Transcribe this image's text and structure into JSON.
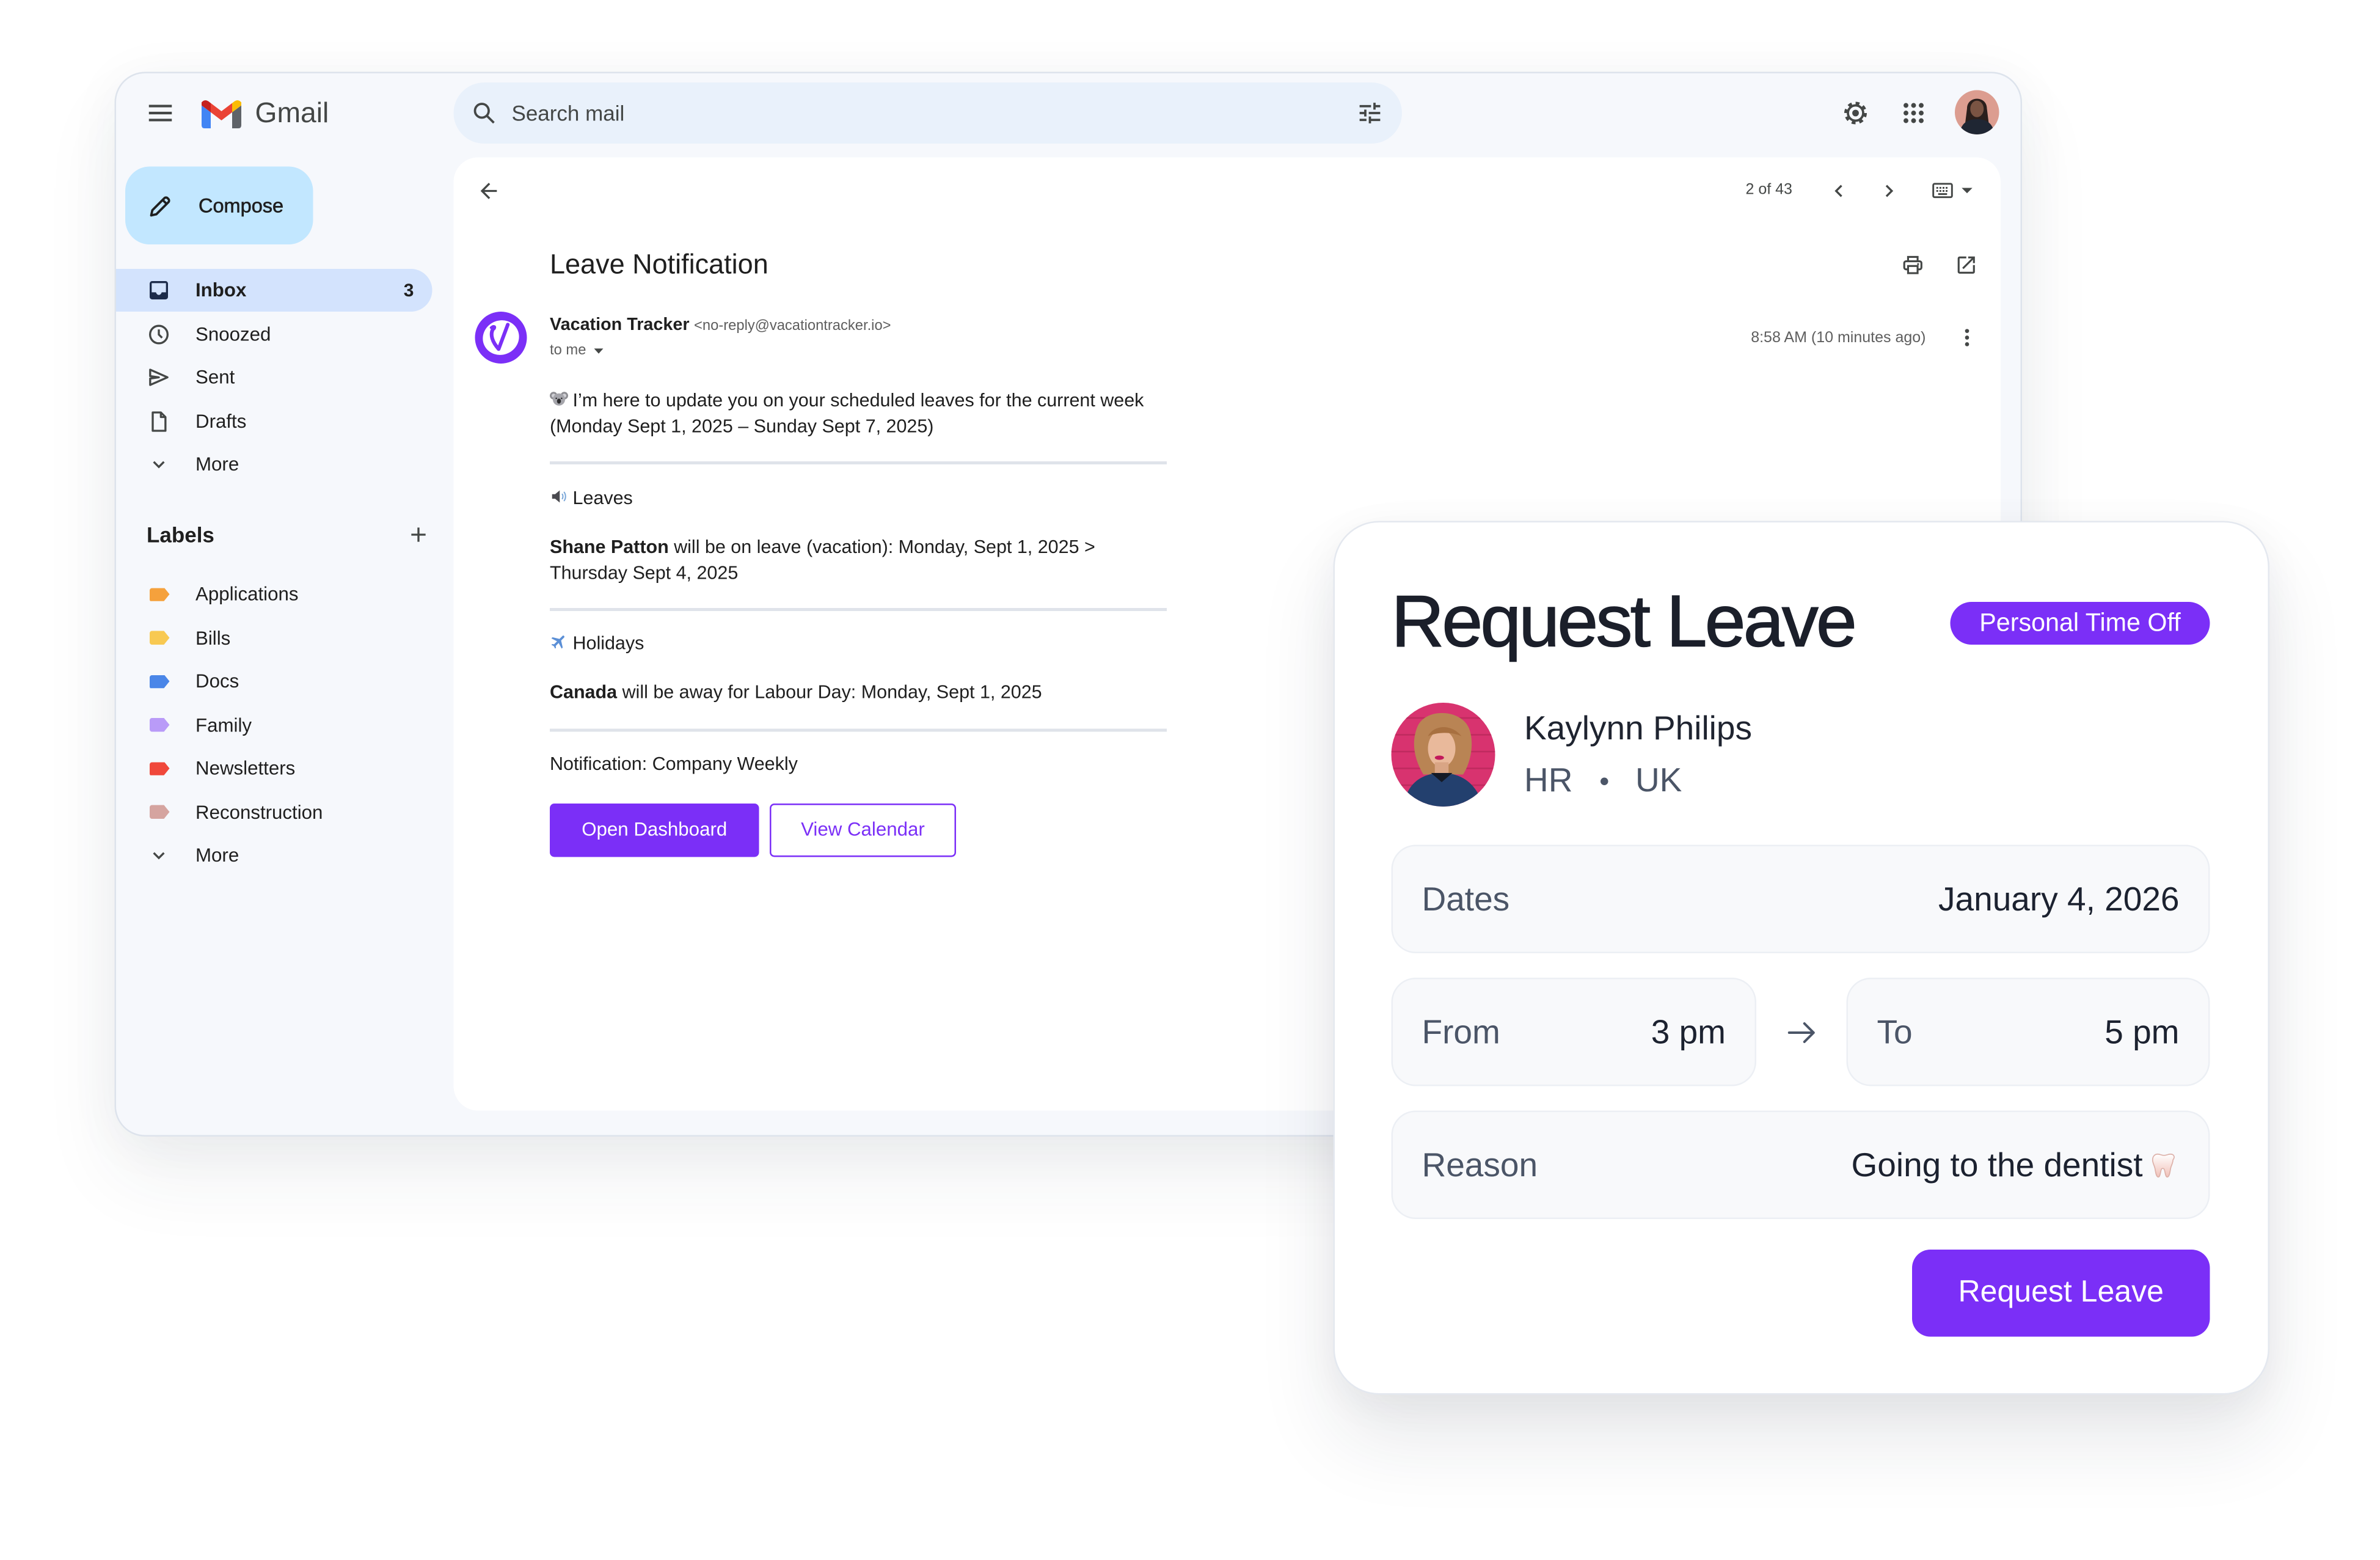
{
  "theme": {
    "accent": "#7b2ff7"
  },
  "app": {
    "name": "Gmail"
  },
  "search": {
    "placeholder": "Search mail"
  },
  "compose": {
    "label": "Compose"
  },
  "nav": [
    {
      "label": "Inbox",
      "count": "3",
      "icon": "inbox-icon"
    },
    {
      "label": "Snoozed",
      "icon": "clock-icon"
    },
    {
      "label": "Sent",
      "icon": "send-icon"
    },
    {
      "label": "Drafts",
      "icon": "draft-icon"
    },
    {
      "label": "More",
      "icon": "chevron-down-icon"
    }
  ],
  "labels": {
    "heading": "Labels",
    "items": [
      {
        "name": "Applications",
        "color": "#f5a13c"
      },
      {
        "name": "Bills",
        "color": "#f8c952"
      },
      {
        "name": "Docs",
        "color": "#4a86e8"
      },
      {
        "name": "Family",
        "color": "#b99bf8"
      },
      {
        "name": "Newsletters",
        "color": "#f0483b"
      },
      {
        "name": "Reconstruction",
        "color": "#d5a4a0"
      }
    ],
    "more": "More"
  },
  "toolbar": {
    "pagination": "2 of 43"
  },
  "email": {
    "subject": "Leave Notification",
    "sender_name": "Vacation Tracker",
    "sender_email": "<no-reply@vacationtracker.io>",
    "recipient": "to me",
    "time": "8:58 AM (10 minutes ago)",
    "intro_icon": "koala-emoji",
    "intro_line1": "I’m here to update you on your scheduled leaves for the current week",
    "intro_line2": "(Monday Sept 1, 2025 – Sunday Sept 7, 2025)",
    "sections": [
      {
        "icon": "speaker-emoji",
        "title": "Leaves",
        "bold": "Shane Patton",
        "text_line1": " will be on leave (vacation): Monday, Sept 1, 2025 >",
        "text_line2": "Thursday Sept 4, 2025"
      },
      {
        "icon": "airplane-emoji",
        "title": "Holidays",
        "bold": "Canada",
        "text_line1": " will be away for Labour Day: Monday, Sept 1, 2025"
      }
    ],
    "footer": "Notification: Company Weekly",
    "buttons": {
      "primary": "Open Dashboard",
      "secondary": "View Calendar"
    }
  },
  "request_card": {
    "title": "Request Leave",
    "badge": "Personal Time Off",
    "employee": {
      "name": "Kaylynn Philips",
      "department": "HR",
      "location": "UK"
    },
    "fields": {
      "dates": {
        "label": "Dates",
        "value": "January 4, 2026"
      },
      "from": {
        "label": "From",
        "value": "3 pm"
      },
      "to": {
        "label": "To",
        "value": "5 pm"
      },
      "reason": {
        "label": "Reason",
        "value": "Going to the dentist",
        "icon": "tooth-emoji"
      }
    },
    "submit_label": "Request Leave"
  }
}
